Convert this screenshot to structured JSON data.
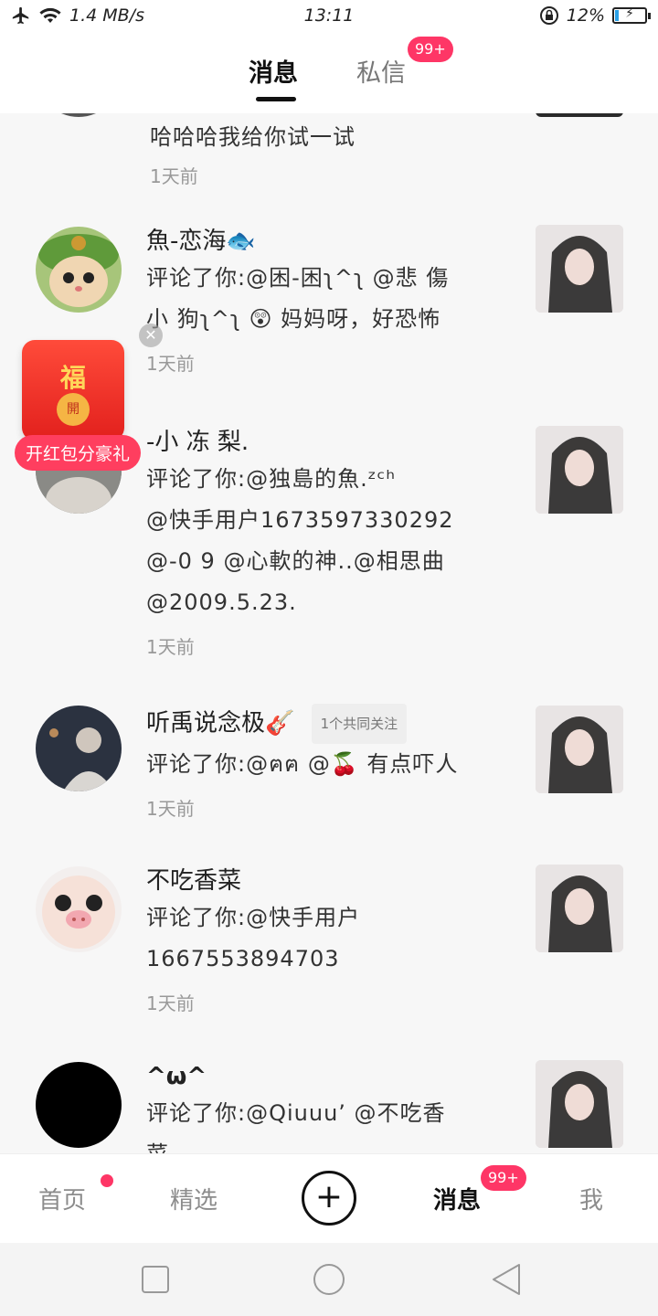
{
  "status_bar": {
    "network_speed": "1.4 MB/s",
    "time": "13:11",
    "battery": "12%",
    "battery_level": 0.12
  },
  "header": {
    "tab_messages": "消息",
    "tab_dm": "私信",
    "dm_badge": "99+"
  },
  "feed": {
    "items": [
      {
        "lines": [
          "哈哈哈我给你试一试"
        ],
        "time": "1天前"
      },
      {
        "name": "魚-恋海🐟",
        "lines": [
          "评论了你:@困-困ʅ^ʅ @悲 傷",
          "小 狗ʅ^ʅ 😲 妈妈呀，好恐怖"
        ],
        "time": "1天前"
      },
      {
        "name": "-小 冻 梨.",
        "lines": [
          "评论了你:@独島的魚.ᶻᶜʰ",
          "@快手用户1673597330292",
          "@-0 9 @心軟的神..@相思曲",
          "@2009.5.23."
        ],
        "time": "1天前"
      },
      {
        "name": "听禹说念极🎸",
        "mutual": "1个共同关注",
        "lines": [
          "评论了你:@ฅฅ @🍒 有点吓人"
        ],
        "time": "1天前"
      },
      {
        "name": "不吃香菜",
        "lines": [
          "评论了你:@快手用户",
          "1667553894703"
        ],
        "time": "1天前"
      },
      {
        "name": "^ω^",
        "lines": [
          "评论了你:@Qiuuu’ @不吃香",
          "菜"
        ]
      }
    ]
  },
  "red_packet": {
    "char": "福",
    "seal": "開",
    "label": "开红包分豪礼"
  },
  "bottom_nav": {
    "home": "首页",
    "featured": "精选",
    "create": "+",
    "messages": "消息",
    "messages_badge": "99+",
    "me": "我"
  },
  "colors": {
    "accent": "#fe3666",
    "background": "#f7f7f7"
  }
}
